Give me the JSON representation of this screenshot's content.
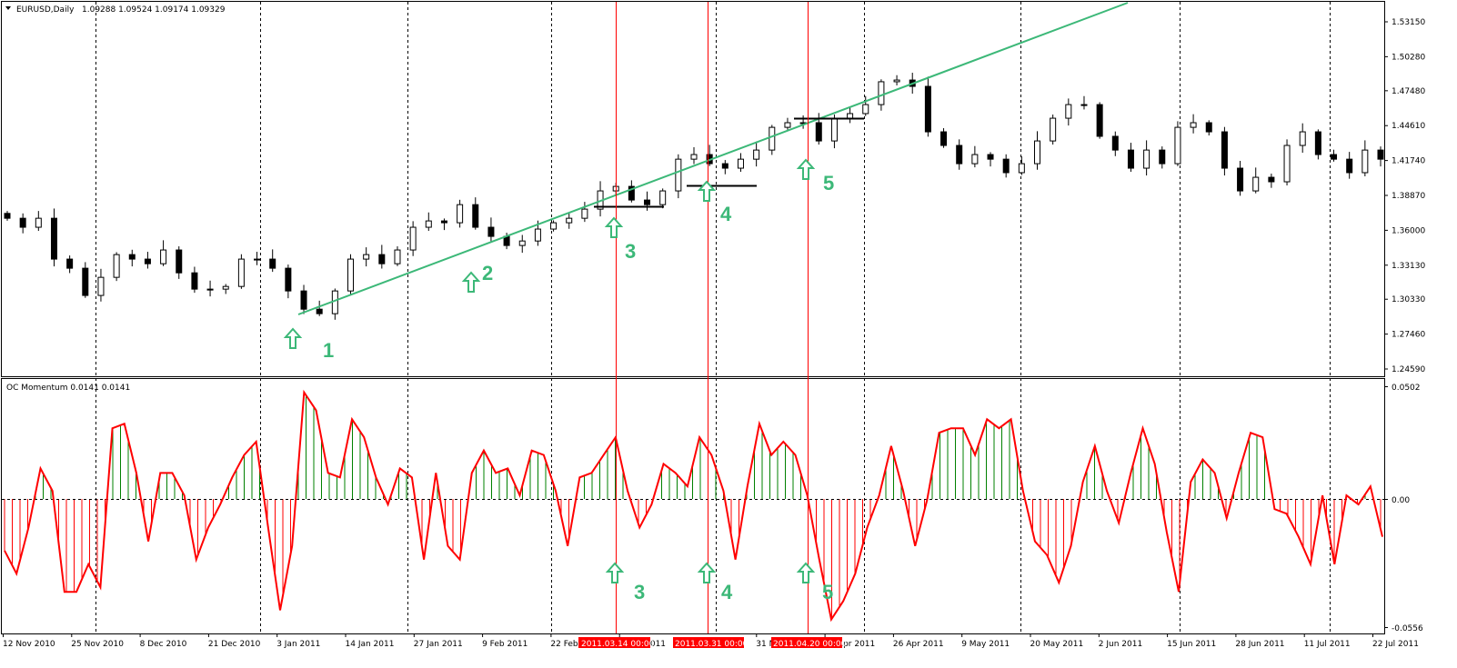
{
  "header": {
    "symbol": "EURUSD,Daily",
    "ohlc": "1.09288 1.09524 1.09174 1.09329"
  },
  "indicator": {
    "title": "OC Momentum 0.0141 0.0141"
  },
  "colors": {
    "bull": "#ffffff",
    "bear": "#000000",
    "trend": "#3cb878",
    "momentum_line": "#ff0000",
    "hist_pos": "#008000",
    "hist_neg": "#ff0000",
    "marker": "#ff0000",
    "annotation": "#3cb878"
  },
  "annotations": {
    "main": [
      "1",
      "2",
      "3",
      "4",
      "5"
    ],
    "sub": [
      "3",
      "4",
      "5"
    ]
  },
  "time_markers": [
    "2011.03.14 00:00",
    "2011.03.31 00:00",
    "2011.04.20 00:00"
  ],
  "chart_data": [
    {
      "type": "candlestick",
      "title": "EURUSD,Daily",
      "x_ticks": [
        "12 Nov 2010",
        "25 Nov 2010",
        "8 Dec 2010",
        "21 Dec 2010",
        "3 Jan 2011",
        "14 Jan 2011",
        "27 Jan 2011",
        "9 Feb 2011",
        "22 Feb 2011",
        "7 Mar 2011",
        "",
        "31 Mar 2011",
        "13 Apr 2011",
        "26 Apr 2011",
        "9 May 2011",
        "20 May 2011",
        "2 Jun 2011",
        "15 Jun 2011",
        "28 Jun 2011",
        "11 Jul 2011",
        "22 Jul 2011"
      ],
      "y_ticks": [
        "1.53150",
        "1.50280",
        "1.47480",
        "1.44610",
        "1.41740",
        "1.38870",
        "1.36000",
        "1.33130",
        "1.30330",
        "1.27460",
        "1.24590"
      ],
      "ylim": [
        1.2459,
        1.5315
      ],
      "closes": [
        1.3699,
        1.3625,
        1.3699,
        1.3363,
        1.3288,
        1.3064,
        1.3213,
        1.34,
        1.3363,
        1.3325,
        1.3438,
        1.325,
        1.3116,
        1.3116,
        1.3138,
        1.3363,
        1.3363,
        1.3288,
        1.3101,
        1.2951,
        1.2914,
        1.3101,
        1.3363,
        1.34,
        1.3325,
        1.3438,
        1.3625,
        1.3677,
        1.3662,
        1.3811,
        1.3625,
        1.355,
        1.3475,
        1.3512,
        1.361,
        1.3662,
        1.3699,
        1.3774,
        1.3924,
        1.3961,
        1.3849,
        1.3811,
        1.3924,
        1.4185,
        1.4223,
        1.4148,
        1.4111,
        1.4185,
        1.426,
        1.4447,
        1.4485,
        1.4485,
        1.4335,
        1.4522,
        1.456,
        1.4634,
        1.4822,
        1.4836,
        1.4784,
        1.441,
        1.4298,
        1.4148,
        1.4223,
        1.4185,
        1.4074,
        1.4148,
        1.4335,
        1.4522,
        1.4634,
        1.4634,
        1.4373,
        1.426,
        1.4111,
        1.426,
        1.4148,
        1.4447,
        1.4485,
        1.441,
        1.4111,
        1.3924,
        1.4036,
        1.3999,
        1.4298,
        1.441,
        1.4223,
        1.4185,
        1.4074,
        1.426,
        1.4185
      ],
      "trendline": {
        "from": [
          "3 Jan 2011",
          1.291
        ],
        "to": [
          "2 May 2011",
          1.547
        ]
      }
    },
    {
      "type": "line+histogram",
      "title": "OC Momentum",
      "y_ticks": [
        "0.0502",
        "0.00",
        "-0.0556"
      ],
      "ylim": [
        -0.0556,
        0.0502
      ],
      "values": [
        -0.0224,
        -0.0324,
        -0.0124,
        0.0136,
        0.0036,
        -0.0403,
        -0.0403,
        -0.0283,
        -0.0383,
        0.0315,
        0.0335,
        0.0116,
        -0.0184,
        0.0116,
        0.0116,
        0.0016,
        -0.0263,
        -0.0124,
        -0.0024,
        0.0096,
        0.0196,
        0.0255,
        -0.0124,
        -0.0483,
        -0.0204,
        0.0475,
        0.0395,
        0.0116,
        0.0096,
        0.0355,
        0.0275,
        0.0096,
        -0.0024,
        0.0136,
        0.0096,
        -0.0263,
        0.0116,
        -0.0204,
        -0.0263,
        0.0116,
        0.0216,
        0.0116,
        0.0136,
        0.0016,
        0.0216,
        0.0196,
        0.0036,
        -0.0204,
        0.0096,
        0.0116,
        0.0196,
        0.0275,
        0.0036,
        -0.0124,
        -0.0024,
        0.0156,
        0.0116,
        0.0056,
        0.0275,
        0.0196,
        0.0036,
        -0.0263,
        0.0056,
        0.0335,
        0.0196,
        0.0255,
        0.0196,
        0.0016,
        -0.0263,
        -0.0523,
        -0.0443,
        -0.0324,
        -0.0124,
        0.0016,
        0.0236,
        0.0036,
        -0.0204,
        -0.0004,
        0.0295,
        0.0315,
        0.0315,
        0.0196,
        0.0355,
        0.0315,
        0.0355,
        0.0036,
        -0.0184,
        -0.0243,
        -0.0363,
        -0.0204,
        0.0076,
        0.0236,
        0.0036,
        -0.0104,
        0.0116,
        0.0315,
        0.0156,
        -0.0144,
        -0.0403,
        0.0076,
        0.0176,
        0.0116,
        -0.0084,
        0.0116,
        0.0295,
        0.0275,
        -0.0044,
        -0.0064,
        -0.0164,
        -0.0283,
        0.0016,
        -0.0283,
        0.0016,
        -0.0024,
        0.0056,
        -0.0164
      ]
    }
  ]
}
